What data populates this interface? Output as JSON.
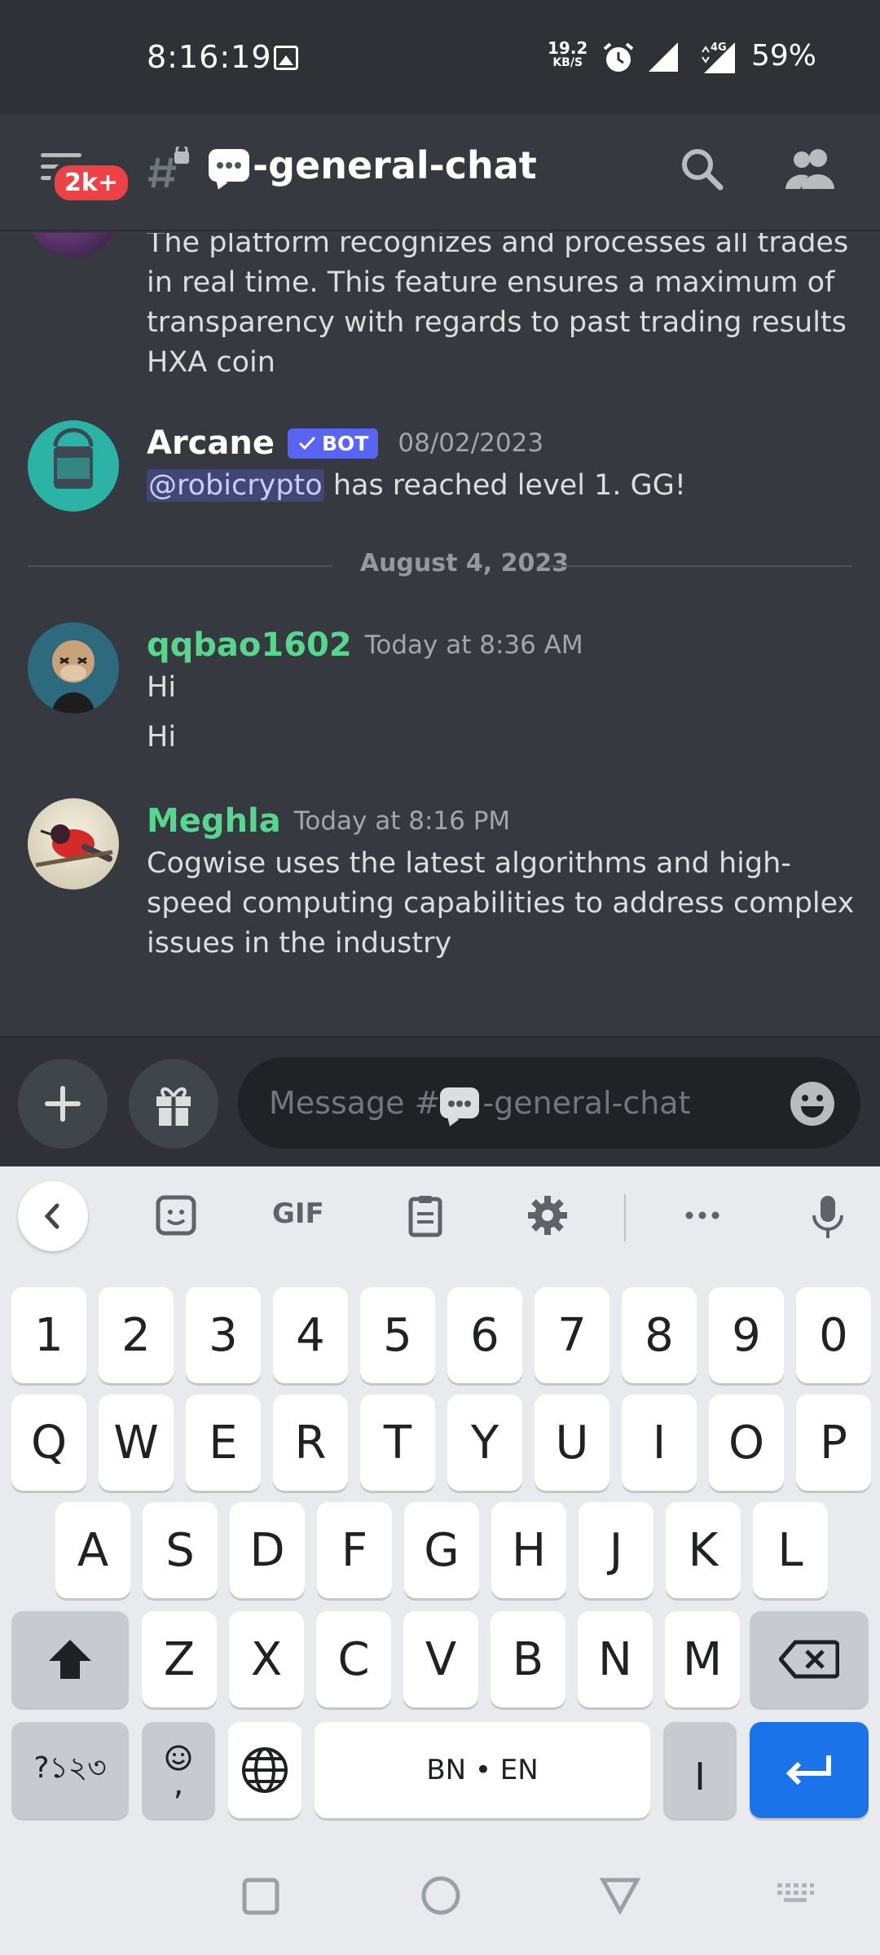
{
  "status_bar": {
    "time": "8:16:19",
    "speed_value": "19.2",
    "speed_unit": "KB/S",
    "battery": "59%"
  },
  "header": {
    "badge": "2k+",
    "channel_name": "-general-chat"
  },
  "messages": {
    "partial": {
      "text": "The platform recognizes and processes all trades in real time. This feature ensures a maximum of transparency with regards to past trading results HXA coin"
    },
    "arcane": {
      "username": "Arcane",
      "bot_label": "BOT",
      "timestamp": "08/02/2023",
      "mention": "@robicrypto",
      "text": " has reached level 1. GG!"
    },
    "date_divider": "August 4, 2023",
    "qqbao": {
      "username": "qqbao1602",
      "timestamp": "Today at 8:36 AM",
      "line1": "Hi",
      "line2": "Hi"
    },
    "meghla": {
      "username": "Meghla",
      "timestamp": "Today at 8:16 PM",
      "text": "Cogwise uses the latest algorithms and high-speed computing capabilities to address complex issues in the industry"
    }
  },
  "composer": {
    "placeholder_prefix": "Message #",
    "placeholder_channel": "-general-chat"
  },
  "keyboard": {
    "toolbar": {
      "gif": "GIF"
    },
    "row_numbers": [
      "1",
      "2",
      "3",
      "4",
      "5",
      "6",
      "7",
      "8",
      "9",
      "0"
    ],
    "row_q": [
      "Q",
      "W",
      "E",
      "R",
      "T",
      "Y",
      "U",
      "I",
      "O",
      "P"
    ],
    "row_a": [
      "A",
      "S",
      "D",
      "F",
      "G",
      "H",
      "J",
      "K",
      "L"
    ],
    "row_z": [
      "Z",
      "X",
      "C",
      "V",
      "B",
      "N",
      "M"
    ],
    "symbols_key": "?১২৩",
    "comma": ",",
    "space_label": "BN • EN",
    "bar_key": "I"
  },
  "colors": {
    "bg": "#36393f",
    "header": "#2f3136",
    "green_user": "#57d68d",
    "blurple": "#5865f2",
    "enter_blue": "#1a73e8"
  }
}
